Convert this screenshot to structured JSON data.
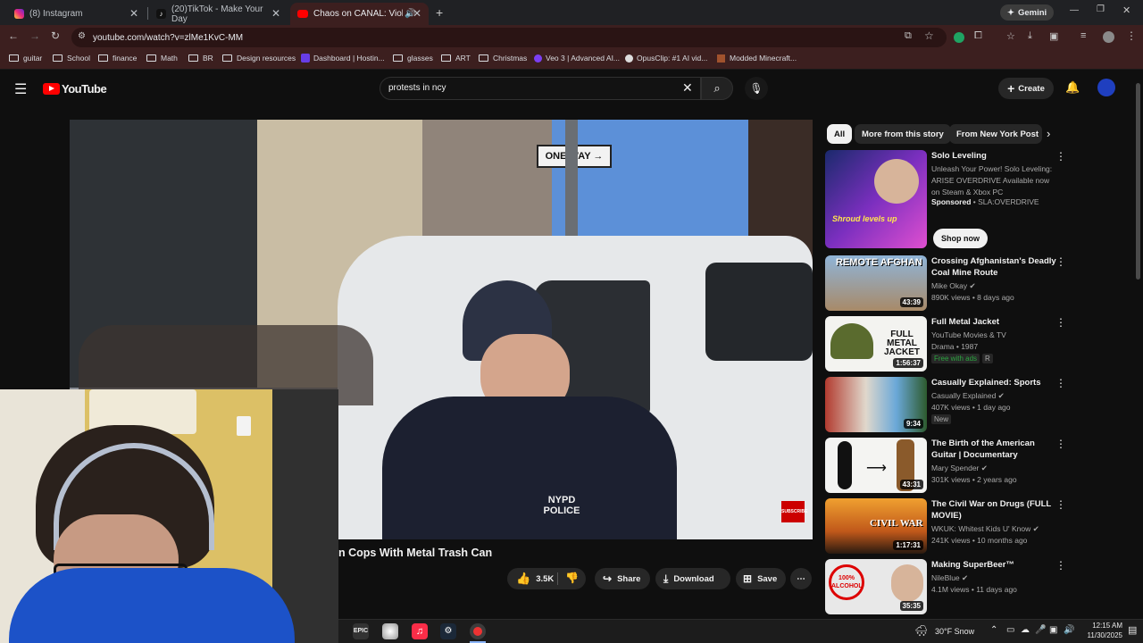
{
  "browser": {
    "tabs": [
      {
        "label": "(8) Instagram"
      },
      {
        "label": "(20)TikTok - Make Your Day"
      },
      {
        "label": "Chaos on CANAL: Violent A"
      }
    ],
    "gemini": "Gemini",
    "url": "youtube.com/watch?v=zlMe1KvC-MM",
    "bookmarks": [
      "guitar",
      "School",
      "finance",
      "Math",
      "BR",
      "Design resources",
      "Dashboard | Hostin...",
      "glasses",
      "ART",
      "Christmas",
      "Veo 3 | Advanced AI...",
      "OpusClip: #1 AI vid...",
      "Modded Minecraft..."
    ]
  },
  "youtube": {
    "logo": "YouTube",
    "search_query": "protests in ncy",
    "create_label": "Create",
    "video_title": "n Cops With Metal Trash Can",
    "likes": "3.5K",
    "share_label": "Share",
    "download_label": "Download",
    "save_label": "Save",
    "subscribe_badge": "SUBSCRIBE",
    "chips": [
      "All",
      "More from this story",
      "From New York Post"
    ],
    "sponsored": {
      "title": "Solo Leveling",
      "desc": "Unleash Your Power! Solo Leveling: ARISE OVERDRIVE Available now on Steam & Xbox PC",
      "tag": "Sponsored",
      "advertiser": "SLA:OVERDRIVE",
      "cta": "Shop now"
    },
    "recs": [
      {
        "title": "Crossing Afghanistan's Deadly Coal Mine Route",
        "channel": "Mike Okay",
        "meta": "890K views • 8 days ago",
        "badge": "",
        "duration": "43:39",
        "thumb_text": "REMOTE AFGHAN"
      },
      {
        "title": "Full Metal Jacket",
        "channel": "YouTube Movies & TV",
        "meta": "Drama • 1987",
        "badge": "Free with ads",
        "badge2": "R",
        "duration": "1:56:37",
        "thumb_text": "FULL METAL JACKET"
      },
      {
        "title": "Casually Explained: Sports",
        "channel": "Casually Explained",
        "meta": "407K views • 1 day ago",
        "badge": "New",
        "duration": "9:34",
        "thumb_text": ""
      },
      {
        "title": "The Birth of the American Guitar | Documentary",
        "channel": "Mary Spender",
        "meta": "301K views • 2 years ago",
        "badge": "",
        "duration": "43:31",
        "thumb_text": ""
      },
      {
        "title": "The Civil War on Drugs (FULL MOVIE)",
        "channel": "WKUK: Whitest Kids U' Know",
        "meta": "241K views • 10 months ago",
        "badge": "",
        "duration": "1:17:31",
        "thumb_text": "CIVIL WAR"
      },
      {
        "title": "Making SuperBeer™",
        "channel": "NileBlue",
        "meta": "4.1M views • 11 days ago",
        "badge": "",
        "duration": "35:35",
        "thumb_text": "100% ALCOHOL"
      }
    ]
  },
  "taskbar": {
    "weather": "30°F  Snow",
    "time": "12:15 AM",
    "date": "11/30/2025"
  }
}
